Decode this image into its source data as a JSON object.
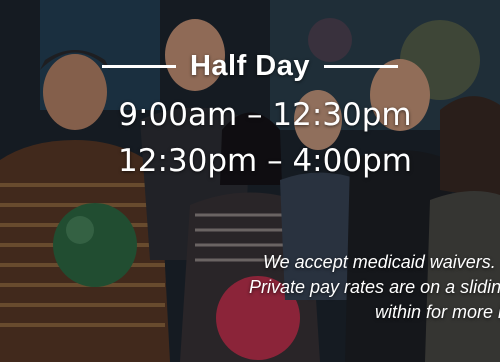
{
  "hero": {
    "heading": "Half Day",
    "times": [
      "9:00am – 12:30pm",
      "12:30pm – 4:00pm"
    ],
    "notes": [
      "We accept medicaid waivers.",
      "Private pay rates are on a sliding scale",
      "within for more info."
    ]
  }
}
